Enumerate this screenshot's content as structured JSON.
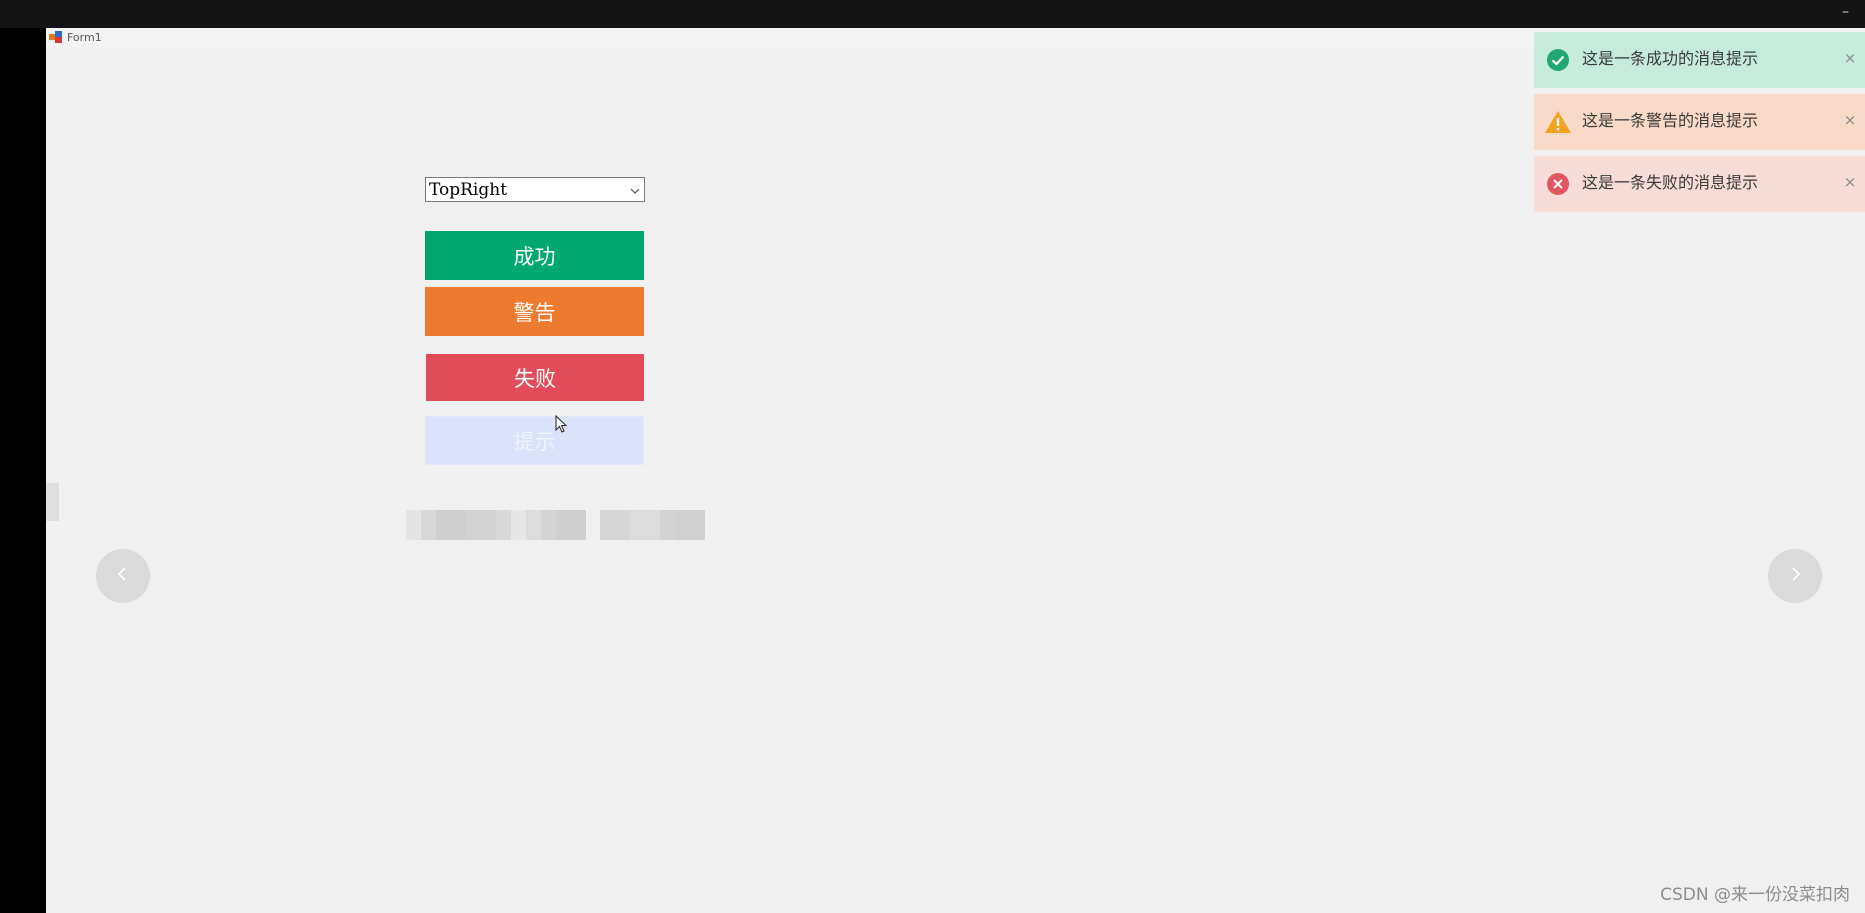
{
  "window": {
    "title": "Form1",
    "minimize_glyph": "–"
  },
  "dropdown": {
    "selected": "TopRight"
  },
  "buttons": {
    "success": "成功",
    "warning": "警告",
    "error": "失败",
    "info": "提示"
  },
  "toasts": [
    {
      "type": "success",
      "message": "这是一条成功的消息提示",
      "close": "×",
      "icon": "check-circle-icon",
      "color": "#21a872"
    },
    {
      "type": "warning",
      "message": "这是一条警告的消息提示",
      "close": "×",
      "icon": "warning-triangle-icon",
      "color": "#f2a21e"
    },
    {
      "type": "error",
      "message": "这是一条失败的消息提示",
      "close": "×",
      "icon": "error-circle-icon",
      "color": "#e2575f"
    }
  ],
  "navigation": {
    "prev_icon": "chevron-left-icon",
    "next_icon": "chevron-right-icon"
  },
  "watermark": "CSDN @来一份没菜扣肉",
  "colors": {
    "success": "#00a86f",
    "warning": "#ec7b30",
    "error": "#e24b5a",
    "info": "#dbe3fc",
    "form_bg": "#f0f0f0"
  }
}
